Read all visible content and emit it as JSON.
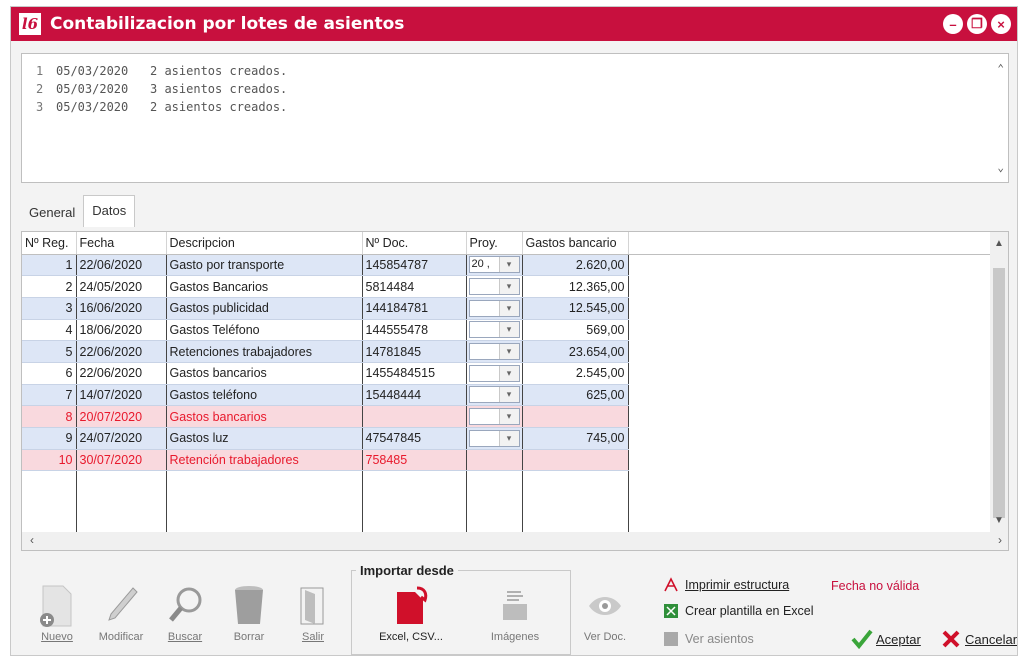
{
  "window": {
    "logo": "l6",
    "title": "Contabilizacion por lotes de asientos",
    "controls": [
      "minimize-icon",
      "restore-icon",
      "close-icon"
    ]
  },
  "log": [
    {
      "n": "1",
      "date": "05/03/2020",
      "text": "2 asientos creados."
    },
    {
      "n": "2",
      "date": "05/03/2020",
      "text": "3 asientos creados."
    },
    {
      "n": "3",
      "date": "05/03/2020",
      "text": "2 asientos creados."
    }
  ],
  "tabs": [
    {
      "label": "General",
      "active": false
    },
    {
      "label": "Datos",
      "active": true
    }
  ],
  "grid": {
    "columns": [
      "Nº Reg.",
      "Fecha",
      "Descripcion",
      "Nº Doc.",
      "Proy.",
      "Gastos bancario"
    ],
    "rows": [
      {
        "reg": "1",
        "fecha": "22/06/2020",
        "desc": "Gasto por transporte",
        "doc": "145854787",
        "proy": "20 ,",
        "gastos": "2.620,00",
        "style": "blue"
      },
      {
        "reg": "2",
        "fecha": "24/05/2020",
        "desc": "Gastos Bancarios",
        "doc": "5814484",
        "proy": "",
        "gastos": "12.365,00",
        "style": "white"
      },
      {
        "reg": "3",
        "fecha": "16/06/2020",
        "desc": "Gastos publicidad",
        "doc": "144184781",
        "proy": "",
        "gastos": "12.545,00",
        "style": "blue"
      },
      {
        "reg": "4",
        "fecha": "18/06/2020",
        "desc": "Gastos Teléfono",
        "doc": "144555478",
        "proy": "",
        "gastos": "569,00",
        "style": "white"
      },
      {
        "reg": "5",
        "fecha": "22/06/2020",
        "desc": "Retenciones trabajadores",
        "doc": "14781845",
        "proy": "",
        "gastos": "23.654,00",
        "style": "blue"
      },
      {
        "reg": "6",
        "fecha": "22/06/2020",
        "desc": "Gastos bancarios",
        "doc": "1455484515",
        "proy": "",
        "gastos": "2.545,00",
        "style": "white"
      },
      {
        "reg": "7",
        "fecha": "14/07/2020",
        "desc": "Gastos teléfono",
        "doc": "15448444",
        "proy": "",
        "gastos": "625,00",
        "style": "blue"
      },
      {
        "reg": "8",
        "fecha": "20/07/2020",
        "desc": "Gastos bancarios",
        "doc": "",
        "proy": "",
        "gastos": "",
        "style": "red"
      },
      {
        "reg": "9",
        "fecha": "24/07/2020",
        "desc": "Gastos luz",
        "doc": "47547845",
        "proy": "",
        "gastos": "745,00",
        "style": "blue"
      },
      {
        "reg": "10",
        "fecha": "30/07/2020",
        "desc": "Retención trabajadores",
        "doc": "758485",
        "proy": "",
        "gastos": "",
        "style": "red",
        "no_proj_box": true
      }
    ]
  },
  "toolbar": {
    "nuevo": "Nuevo",
    "modificar": "Modificar",
    "buscar": "Buscar",
    "borrar": "Borrar",
    "salir": "Salir",
    "import_title": "Importar desde",
    "excel": "Excel, CSV...",
    "imagenes": "Imágenes",
    "ver_doc": "Ver Doc.",
    "imprimir": "Imprimir estructura",
    "crear_plantilla": "Crear plantilla en Excel",
    "ver_asientos": "Ver asientos",
    "error": "Fecha no válida",
    "aceptar": "Aceptar",
    "cancelar": "Cancelar"
  },
  "colors": {
    "brand": "#c8103e",
    "row_blue": "#dde6f6",
    "row_red": "#f9d9de",
    "error_text": "#e8192c"
  }
}
